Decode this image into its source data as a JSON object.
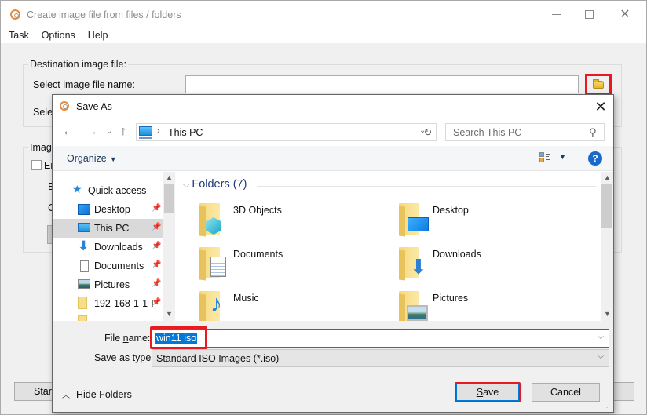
{
  "main_window": {
    "title": "Create image file from files / folders",
    "menu": [
      {
        "label": "Task"
      },
      {
        "label": "Options"
      },
      {
        "label": "Help"
      }
    ],
    "destination_group_label": "Destination image file:",
    "select_image_file_name_label": "Select image file name:",
    "select_label_partial": "Selec",
    "image_group_label_partial": "Image",
    "checkbox_label_partial": "En",
    "row_e_partial": "E",
    "row_c_partial": "C",
    "start_button_partial": "Start",
    "destination_input_value": ""
  },
  "save_as": {
    "title": "Save As",
    "address": {
      "location": "This PC",
      "breadcrumb_separator": "›"
    },
    "search_placeholder": "Search This PC",
    "toolbar": {
      "organize_label": "Organize",
      "help_glyph": "?"
    },
    "nav_pane": {
      "items": [
        {
          "label": "Quick access",
          "icon": "star-icon",
          "pinned": false,
          "selected": false
        },
        {
          "label": "Desktop",
          "icon": "desktop-icon",
          "pinned": true,
          "selected": false
        },
        {
          "label": "This PC",
          "icon": "this-pc-icon",
          "pinned": true,
          "selected": true
        },
        {
          "label": "Downloads",
          "icon": "download-icon",
          "pinned": true,
          "selected": false
        },
        {
          "label": "Documents",
          "icon": "documents-icon",
          "pinned": true,
          "selected": false
        },
        {
          "label": "Pictures",
          "icon": "pictures-icon",
          "pinned": true,
          "selected": false
        },
        {
          "label": "192-168-1-1-I",
          "icon": "folder-icon",
          "pinned": true,
          "selected": false
        }
      ]
    },
    "content": {
      "group_header": "Folders (7)",
      "folders": [
        {
          "name": "3D Objects",
          "icon": "3d-objects-icon"
        },
        {
          "name": "Desktop",
          "icon": "desktop-icon"
        },
        {
          "name": "Documents",
          "icon": "documents-icon"
        },
        {
          "name": "Downloads",
          "icon": "download-icon"
        },
        {
          "name": "Music",
          "icon": "music-icon"
        },
        {
          "name": "Pictures",
          "icon": "pictures-icon"
        }
      ]
    },
    "file_name_label_pre": "File ",
    "file_name_label_ul": "n",
    "file_name_label_post": "ame:",
    "file_name_value": "win11 iso",
    "save_as_type_label_pre": "Save as ",
    "save_as_type_label_ul": "t",
    "save_as_type_label_post": "ype:",
    "save_as_type_value": "Standard ISO Images (*.iso)",
    "hide_folders_label": "Hide Folders",
    "save_label_ul": "S",
    "save_label_rest": "ave",
    "cancel_label": "Cancel"
  },
  "colors": {
    "highlight_red": "#e8191f",
    "selection_blue": "#0078d7",
    "group_header_blue": "#1e3a7a"
  }
}
